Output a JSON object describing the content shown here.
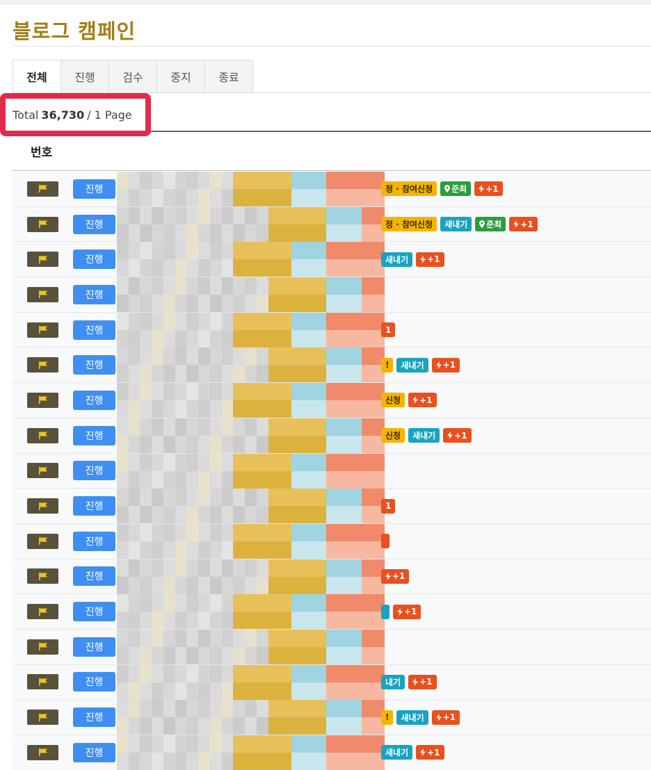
{
  "page": {
    "title": "블로그 캠페인"
  },
  "tabs": [
    {
      "label": "전체",
      "active": true
    },
    {
      "label": "진행",
      "active": false
    },
    {
      "label": "검수",
      "active": false
    },
    {
      "label": "중지",
      "active": false
    },
    {
      "label": "종료",
      "active": false
    }
  ],
  "summary": {
    "prefix": "Total",
    "count": "36,730",
    "suffix": "/ 1 Page"
  },
  "table": {
    "header": "번호"
  },
  "colors": {
    "accent": "#a27e1a",
    "highlight": "#e22a4a",
    "status": "#3f8ff2",
    "flag": "#58523a"
  },
  "rows": [
    {
      "status": "진행",
      "tags": [
        {
          "text": "정 · 참여신청",
          "color": "yellow"
        },
        {
          "text": "준최",
          "color": "green",
          "icon": "pin"
        },
        {
          "text": "+1",
          "color": "red",
          "icon": "bolt"
        }
      ]
    },
    {
      "status": "진행",
      "tags": [
        {
          "text": "정 · 참여신청",
          "color": "yellow"
        },
        {
          "text": "새내기",
          "color": "blue"
        },
        {
          "text": "준최",
          "color": "green",
          "icon": "pin"
        },
        {
          "text": "+1",
          "color": "red",
          "icon": "bolt"
        }
      ]
    },
    {
      "status": "진행",
      "tags": [
        {
          "text": "새내기",
          "color": "blue"
        },
        {
          "text": "+1",
          "color": "red",
          "icon": "bolt"
        }
      ]
    },
    {
      "status": "진행",
      "tags": []
    },
    {
      "status": "진행",
      "tags": [
        {
          "text": "1",
          "color": "red"
        }
      ]
    },
    {
      "status": "진행",
      "tags": [
        {
          "text": "!",
          "color": "yellow"
        },
        {
          "text": "새내기",
          "color": "blue"
        },
        {
          "text": "+1",
          "color": "red",
          "icon": "bolt"
        }
      ]
    },
    {
      "status": "진행",
      "tags": [
        {
          "text": "신청",
          "color": "yellow"
        },
        {
          "text": "+1",
          "color": "red",
          "icon": "bolt"
        }
      ]
    },
    {
      "status": "진행",
      "tags": [
        {
          "text": "신청",
          "color": "yellow"
        },
        {
          "text": "새내기",
          "color": "blue"
        },
        {
          "text": "+1",
          "color": "red",
          "icon": "bolt"
        }
      ]
    },
    {
      "status": "진행",
      "tags": []
    },
    {
      "status": "진행",
      "tags": [
        {
          "text": "1",
          "color": "red"
        }
      ]
    },
    {
      "status": "진행",
      "tags": [
        {
          "text": "",
          "color": "red"
        }
      ]
    },
    {
      "status": "진행",
      "tags": [
        {
          "text": "+1",
          "color": "red",
          "icon": "bolt"
        }
      ]
    },
    {
      "status": "진행",
      "tags": [
        {
          "text": "",
          "color": "blue"
        },
        {
          "text": "+1",
          "color": "red",
          "icon": "bolt"
        }
      ]
    },
    {
      "status": "진행",
      "tags": []
    },
    {
      "status": "진행",
      "tags": [
        {
          "text": "내기",
          "color": "blue"
        },
        {
          "text": "+1",
          "color": "red",
          "icon": "bolt"
        }
      ]
    },
    {
      "status": "진행",
      "tags": [
        {
          "text": "!",
          "color": "yellow"
        },
        {
          "text": "새내기",
          "color": "blue"
        },
        {
          "text": "+1",
          "color": "red",
          "icon": "bolt"
        }
      ]
    },
    {
      "status": "진행",
      "tags": [
        {
          "text": "새내기",
          "color": "blue"
        },
        {
          "text": "+1",
          "color": "red",
          "icon": "bolt"
        }
      ]
    }
  ]
}
